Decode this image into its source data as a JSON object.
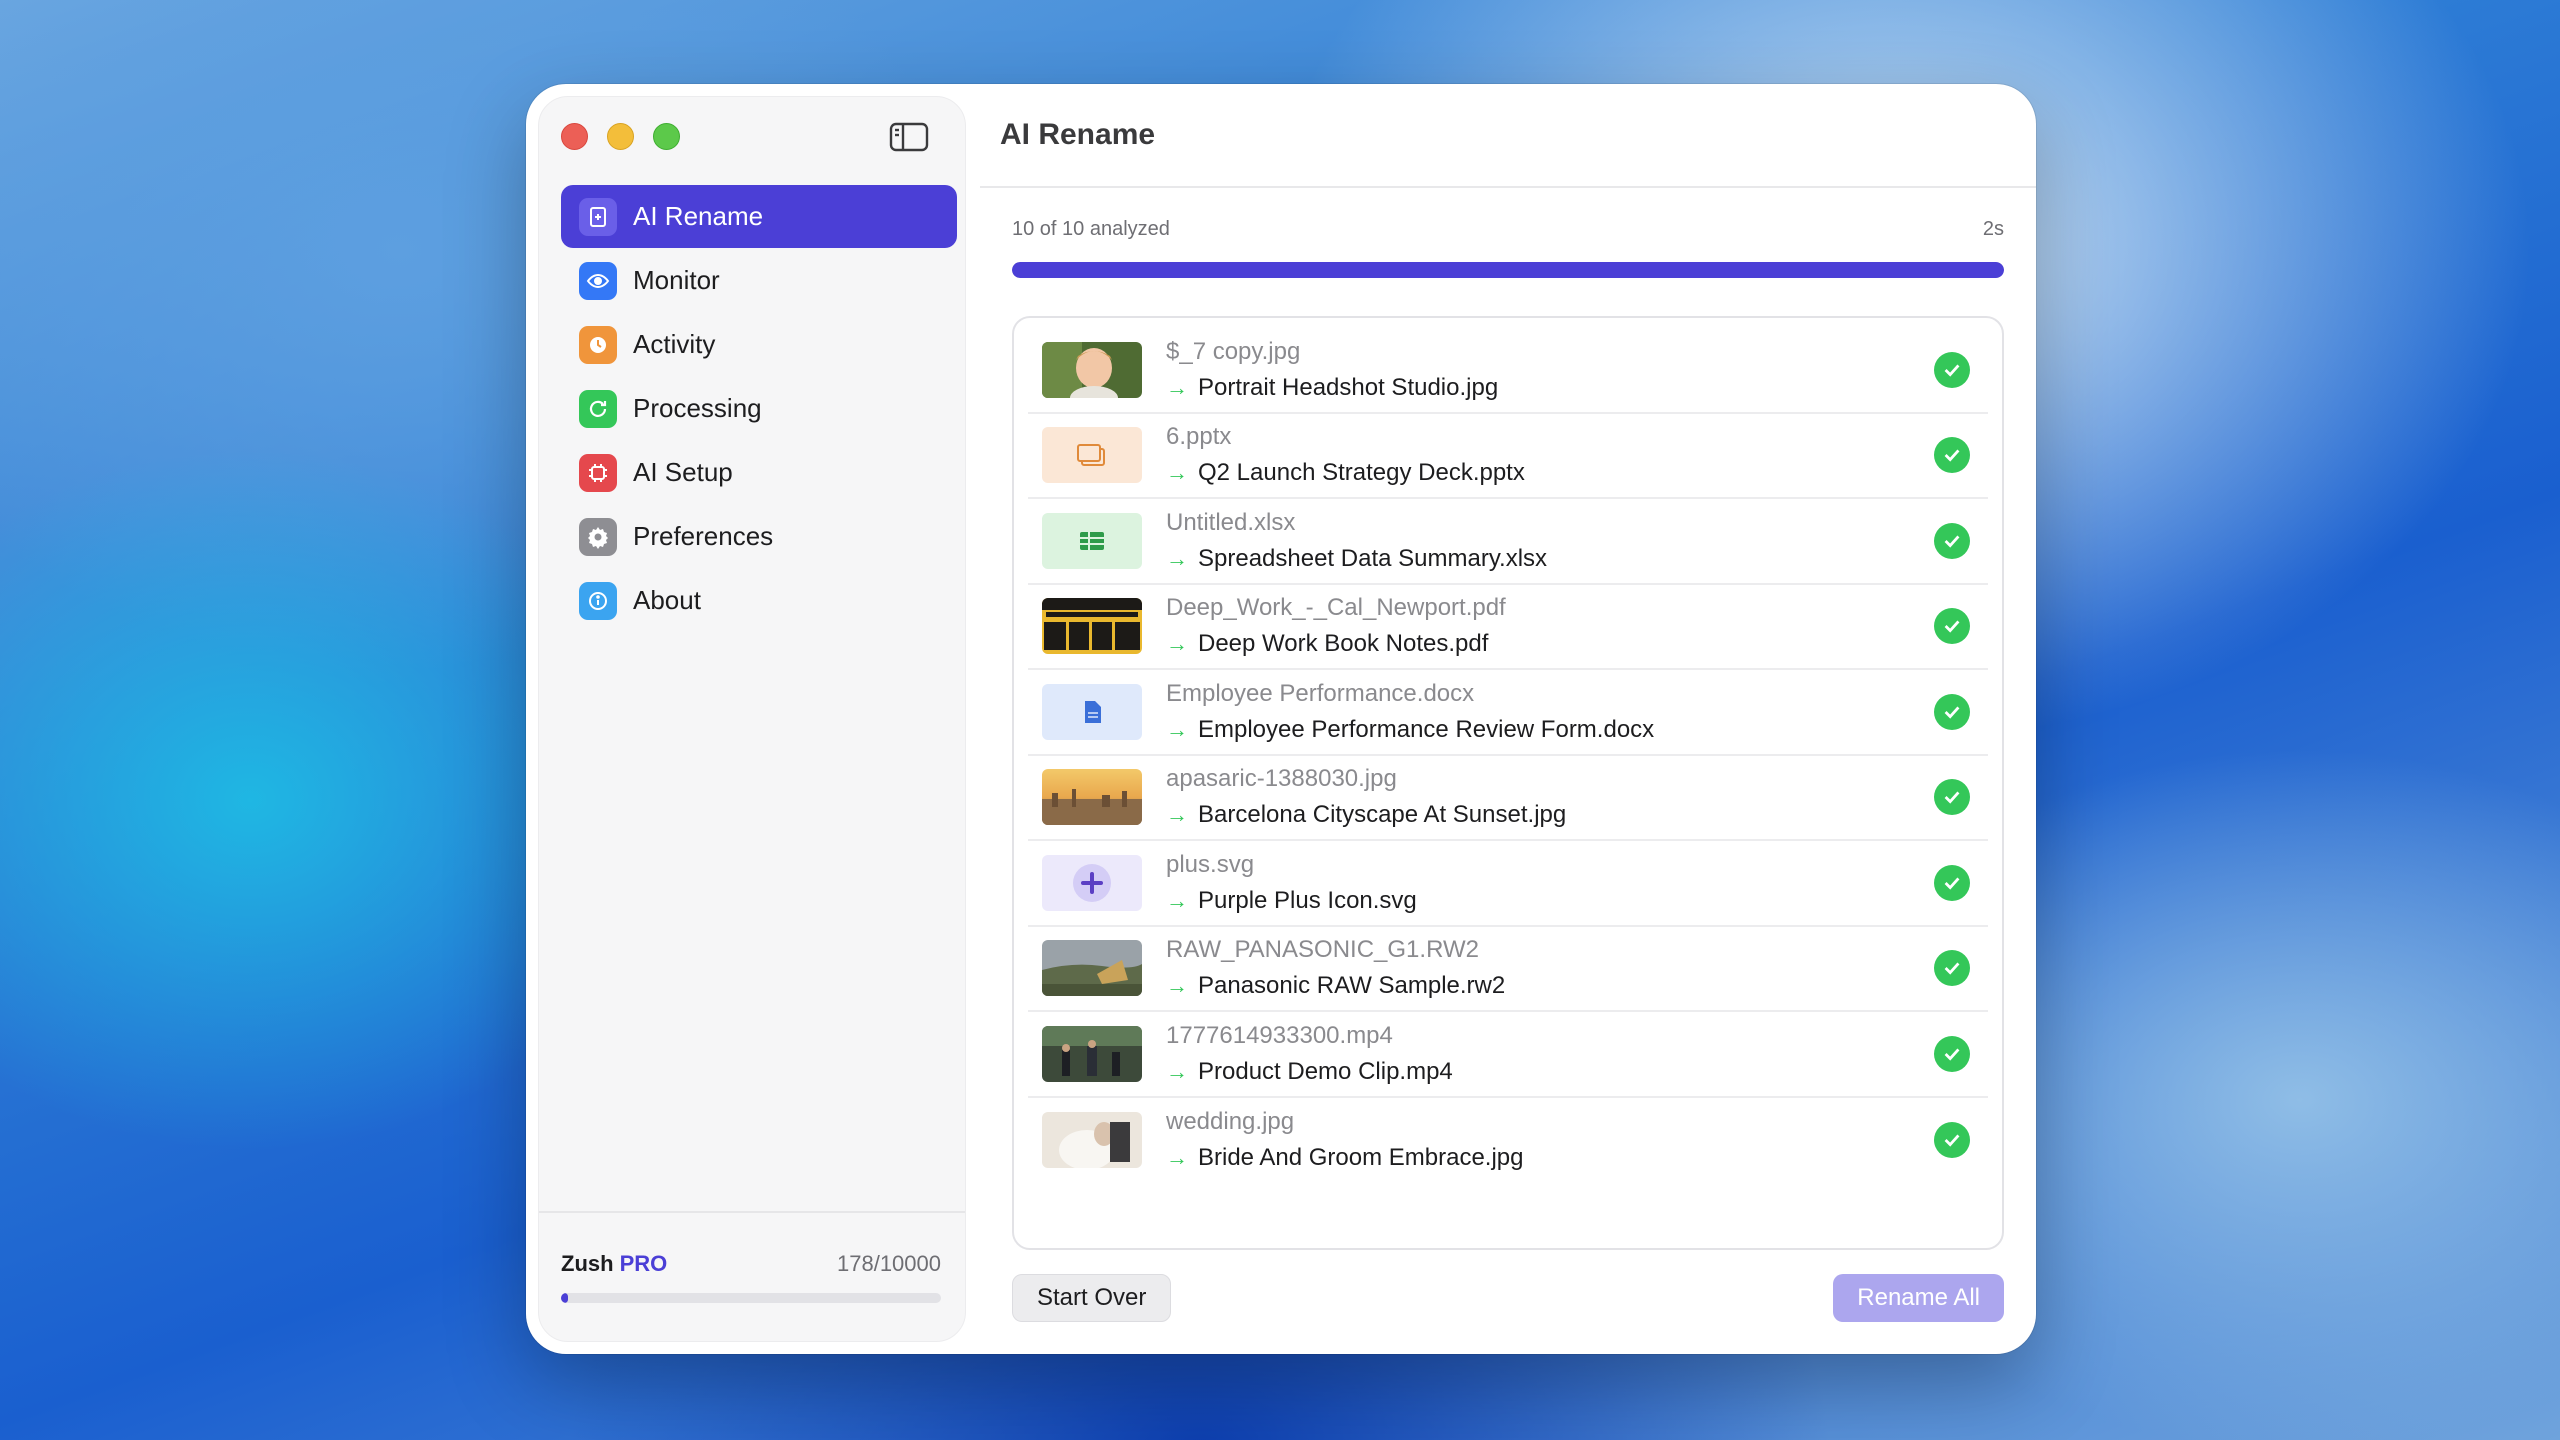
{
  "window": {
    "title": "AI Rename"
  },
  "sidebar": {
    "items": [
      {
        "label": "AI Rename",
        "icon": "sparkle-file-icon",
        "color": "#4b3fd6",
        "active": true
      },
      {
        "label": "Monitor",
        "icon": "eye-icon",
        "color": "#3478f6",
        "active": false
      },
      {
        "label": "Activity",
        "icon": "clock-icon",
        "color": "#f0953b",
        "active": false
      },
      {
        "label": "Processing",
        "icon": "refresh-icon",
        "color": "#34c759",
        "active": false
      },
      {
        "label": "AI Setup",
        "icon": "chip-icon",
        "color": "#e5484d",
        "active": false
      },
      {
        "label": "Preferences",
        "icon": "gear-icon",
        "color": "#8e8e93",
        "active": false
      },
      {
        "label": "About",
        "icon": "info-icon",
        "color": "#3ba4f0",
        "active": false
      }
    ],
    "footer": {
      "plan_name": "Zush",
      "plan_tier": "PRO",
      "usage_text": "178/10000",
      "usage_fraction": 0.0178
    }
  },
  "progress": {
    "status": "10 of 10 analyzed",
    "elapsed": "2s",
    "fraction": 1.0
  },
  "files": [
    {
      "original": "$_7 copy.jpg",
      "renamed": "Portrait Headshot Studio.jpg",
      "thumb": "photo-child",
      "done": true
    },
    {
      "original": "6.pptx",
      "renamed": "Q2 Launch Strategy Deck.pptx",
      "thumb": "pptx",
      "done": true
    },
    {
      "original": "Untitled.xlsx",
      "renamed": "Spreadsheet Data Summary.xlsx",
      "thumb": "xlsx",
      "done": true
    },
    {
      "original": "Deep_Work_-_Cal_Newport.pdf",
      "renamed": "Deep Work Book Notes.pdf",
      "thumb": "book-cover",
      "done": true
    },
    {
      "original": "Employee Performance.docx",
      "renamed": "Employee Performance Review Form.docx",
      "thumb": "docx",
      "done": true
    },
    {
      "original": "apasaric-1388030.jpg",
      "renamed": "Barcelona Cityscape At Sunset.jpg",
      "thumb": "photo-city",
      "done": true
    },
    {
      "original": "plus.svg",
      "renamed": "Purple Plus Icon.svg",
      "thumb": "svg-plus",
      "done": true
    },
    {
      "original": "RAW_PANASONIC_G1.RW2",
      "renamed": "Panasonic RAW Sample.rw2",
      "thumb": "photo-landscape",
      "done": true
    },
    {
      "original": "1777614933300.mp4",
      "renamed": "Product Demo Clip.mp4",
      "thumb": "photo-video",
      "done": true
    },
    {
      "original": "wedding.jpg",
      "renamed": "Bride And Groom Embrace.jpg",
      "thumb": "photo-wedding",
      "done": true
    }
  ],
  "actions": {
    "start_over": "Start Over",
    "rename_all": "Rename All"
  },
  "colors": {
    "accent": "#4b3fd6",
    "success": "#34c759",
    "button_disabled": "#aca6ee"
  }
}
